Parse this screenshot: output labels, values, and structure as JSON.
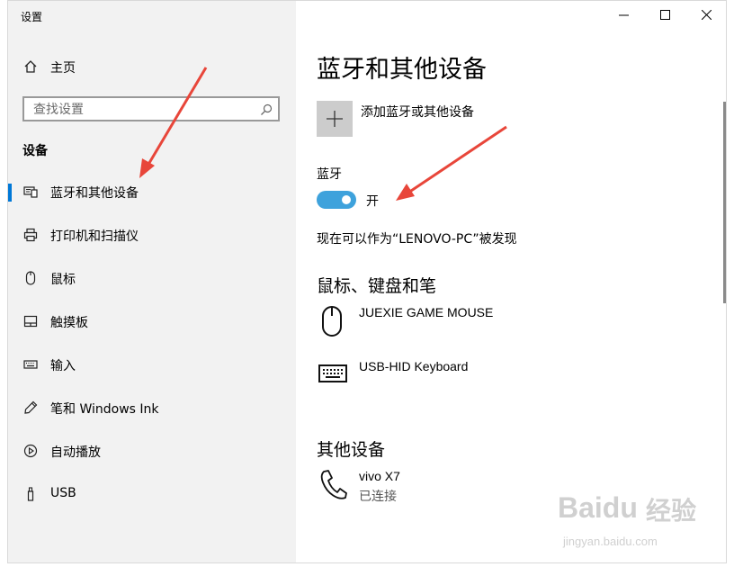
{
  "window": {
    "title": "设置"
  },
  "sidebar": {
    "home_label": "主页",
    "search_placeholder": "查找设置",
    "section_heading": "设备",
    "items": [
      {
        "label": "蓝牙和其他设备",
        "icon": "bluetooth-devices-icon",
        "active": true
      },
      {
        "label": "打印机和扫描仪",
        "icon": "printer-icon"
      },
      {
        "label": "鼠标",
        "icon": "mouse-icon"
      },
      {
        "label": "触摸板",
        "icon": "touchpad-icon"
      },
      {
        "label": "输入",
        "icon": "keyboard-icon"
      },
      {
        "label": "笔和 Windows Ink",
        "icon": "pen-icon"
      },
      {
        "label": "自动播放",
        "icon": "autoplay-icon"
      },
      {
        "label": "USB",
        "icon": "usb-icon"
      }
    ]
  },
  "main": {
    "title": "蓝牙和其他设备",
    "add_device_label": "添加蓝牙或其他设备",
    "bluetooth_label": "蓝牙",
    "bluetooth_state": "开",
    "bluetooth_on": true,
    "discoverable_text": "现在可以作为“LENOVO-PC”被发现",
    "mouse_section_heading": "鼠标、键盘和笔",
    "mouse_devices": [
      {
        "name": "JUEXIE GAME MOUSE",
        "icon": "mouse-device-icon"
      },
      {
        "name": "USB-HID Keyboard",
        "icon": "keyboard-device-icon"
      }
    ],
    "other_section_heading": "其他设备",
    "other_devices": [
      {
        "name": "vivo X7",
        "status": "已连接",
        "icon": "phone-icon"
      }
    ]
  },
  "colors": {
    "accent": "#0078d7",
    "toggle_on": "#3ea2dc",
    "arrow": "#e8463a",
    "sidebar_bg": "#f2f2f2"
  },
  "watermark": {
    "brand": "Baidu",
    "brand_cn": "经验",
    "url": "jingyan.baidu.com"
  }
}
